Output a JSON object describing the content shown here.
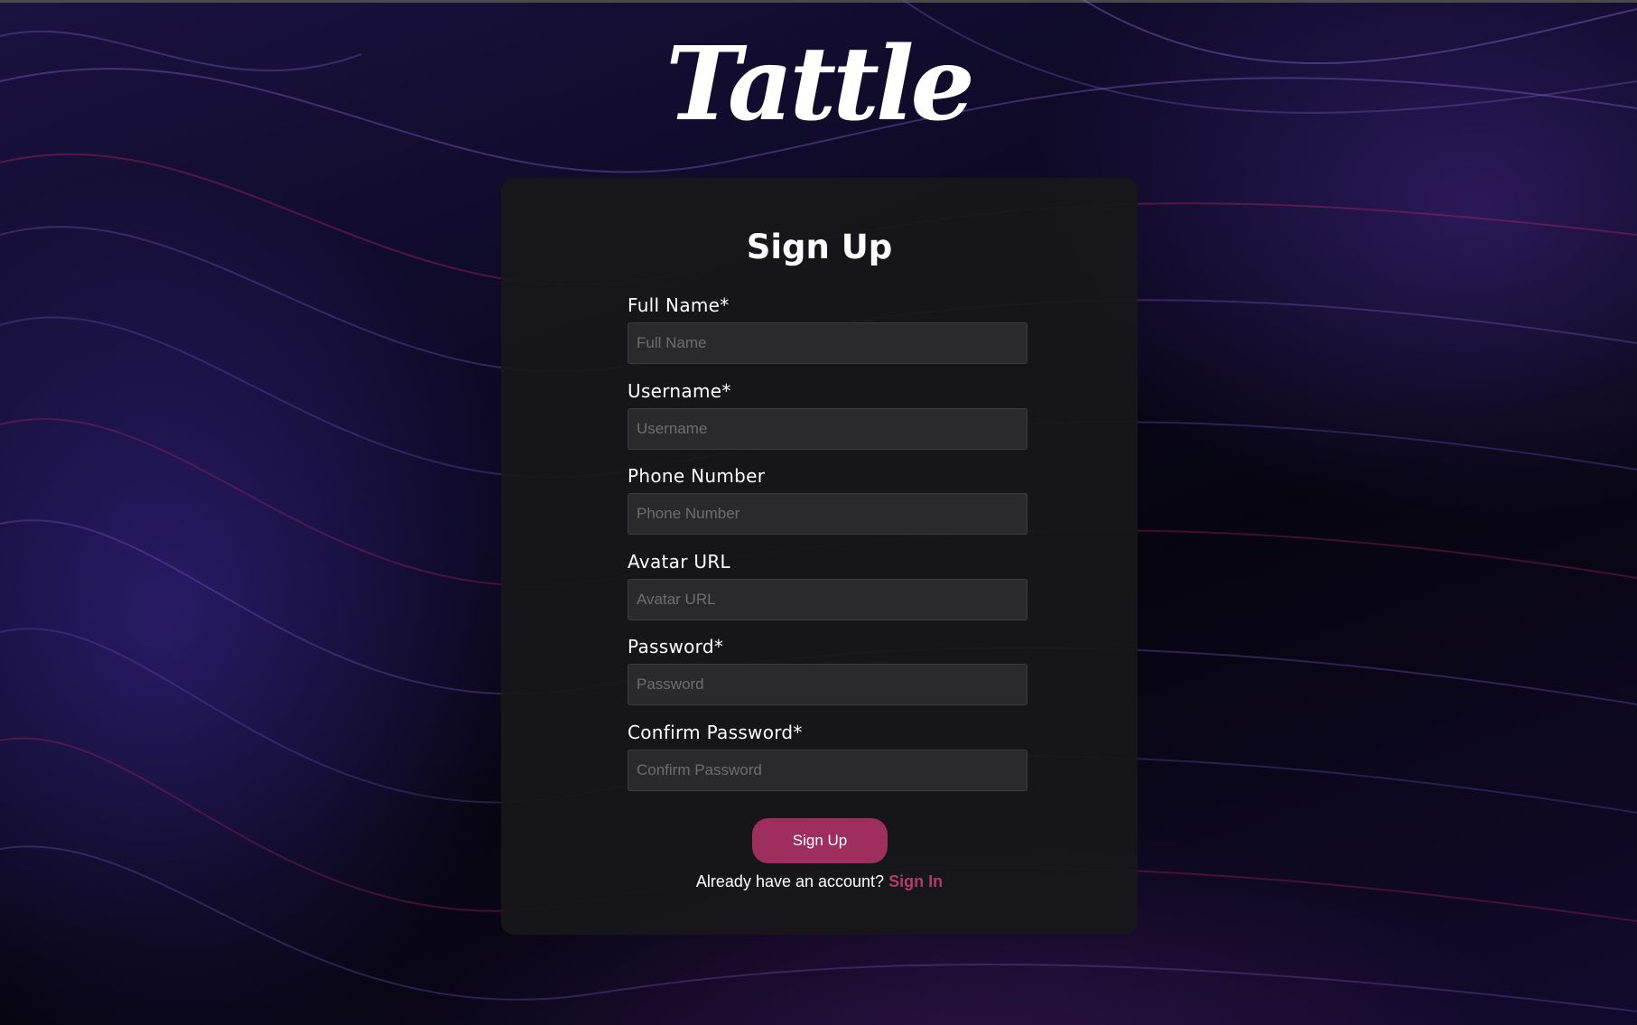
{
  "brand": {
    "logo_text": "Tattle"
  },
  "colors": {
    "accent": "#9e2e5c",
    "link": "#b03c6c",
    "card_bg": "#18181a",
    "input_bg": "#2a2a2c"
  },
  "form": {
    "title": "Sign Up",
    "fields": [
      {
        "label": "Full Name*",
        "placeholder": "Full Name",
        "value": ""
      },
      {
        "label": "Username*",
        "placeholder": "Username",
        "value": ""
      },
      {
        "label": "Phone Number",
        "placeholder": "Phone Number",
        "value": ""
      },
      {
        "label": "Avatar URL",
        "placeholder": "Avatar URL",
        "value": ""
      },
      {
        "label": "Password*",
        "placeholder": "Password",
        "value": ""
      },
      {
        "label": "Confirm Password*",
        "placeholder": "Confirm Password",
        "value": ""
      }
    ],
    "submit_label": "Sign Up",
    "footer_text": "Already have an account?",
    "footer_link": "Sign In"
  }
}
